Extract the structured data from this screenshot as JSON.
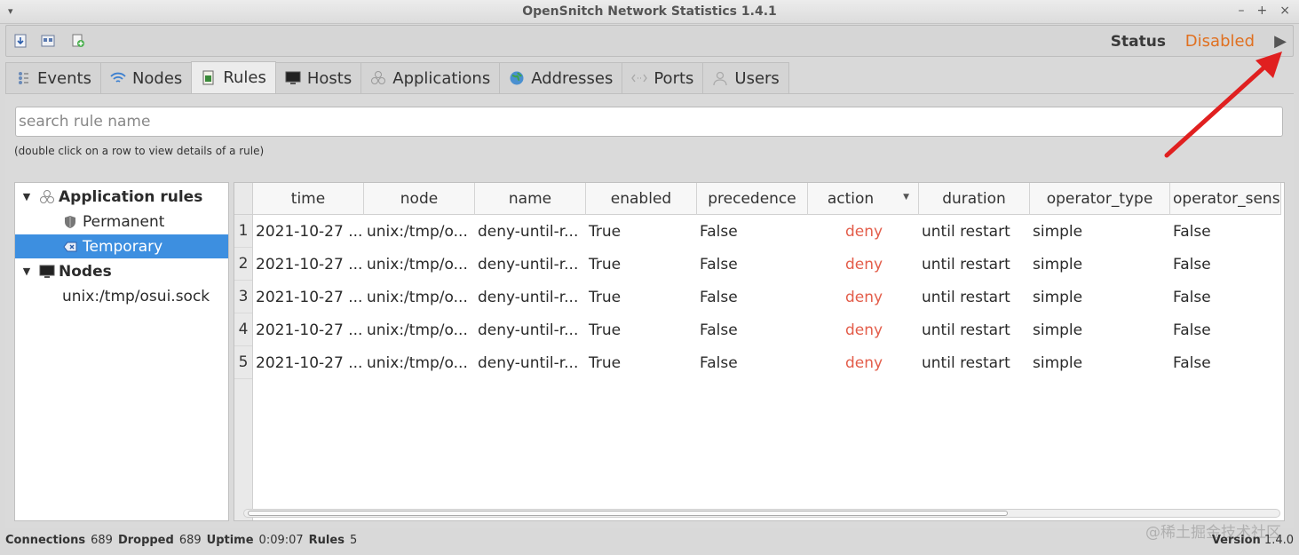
{
  "window": {
    "title": "OpenSnitch Network Statistics 1.4.1",
    "menu_glyph": "▾",
    "controls": [
      "–",
      "+",
      "×"
    ]
  },
  "toolbar": {
    "status_label": "Status",
    "status_value": "Disabled",
    "status_color": "#e07020",
    "play_glyph": "▶"
  },
  "tabs": [
    {
      "label": "Events",
      "icon": "events-icon"
    },
    {
      "label": "Nodes",
      "icon": "wifi-icon"
    },
    {
      "label": "Rules",
      "icon": "rules-icon",
      "active": true
    },
    {
      "label": "Hosts",
      "icon": "monitor-icon"
    },
    {
      "label": "Applications",
      "icon": "applications-icon"
    },
    {
      "label": "Addresses",
      "icon": "globe-icon"
    },
    {
      "label": "Ports",
      "icon": "ports-icon"
    },
    {
      "label": "Users",
      "icon": "users-icon"
    }
  ],
  "search": {
    "placeholder": "search rule name"
  },
  "hint": "(double click on a row to view details of a rule)",
  "tree": {
    "app_rules": "Application rules",
    "permanent": "Permanent",
    "temporary": "Temporary",
    "nodes": "Nodes",
    "node_item": "unix:/tmp/osui.sock"
  },
  "table": {
    "columns": [
      "time",
      "node",
      "name",
      "enabled",
      "precedence",
      "action",
      "duration",
      "operator_type",
      "operator_sensiti"
    ],
    "sort_glyph": "▼",
    "rows": [
      {
        "num": "1",
        "cells": [
          "2021-10-27 ...",
          "unix:/tmp/o...",
          "deny-until-r...",
          "True",
          "False",
          "deny",
          "until restart",
          "simple",
          "False"
        ]
      },
      {
        "num": "2",
        "cells": [
          "2021-10-27 ...",
          "unix:/tmp/o...",
          "deny-until-r...",
          "True",
          "False",
          "deny",
          "until restart",
          "simple",
          "False"
        ]
      },
      {
        "num": "3",
        "cells": [
          "2021-10-27 ...",
          "unix:/tmp/o...",
          "deny-until-r...",
          "True",
          "False",
          "deny",
          "until restart",
          "simple",
          "False"
        ]
      },
      {
        "num": "4",
        "cells": [
          "2021-10-27 ...",
          "unix:/tmp/o...",
          "deny-until-r...",
          "True",
          "False",
          "deny",
          "until restart",
          "simple",
          "False"
        ]
      },
      {
        "num": "5",
        "cells": [
          "2021-10-27 ...",
          "unix:/tmp/o...",
          "deny-until-r...",
          "True",
          "False",
          "deny",
          "until restart",
          "simple",
          "False"
        ]
      }
    ]
  },
  "statusbar": {
    "connections_label": "Connections",
    "connections": "689",
    "dropped_label": "Dropped",
    "dropped": "689",
    "uptime_label": "Uptime",
    "uptime": "0:09:07",
    "rules_label": "Rules",
    "rules": "5",
    "version_label": "Version",
    "version": "1.4.0"
  },
  "watermark": "@稀土掘金技术社区",
  "annotation_color": "#e02020"
}
